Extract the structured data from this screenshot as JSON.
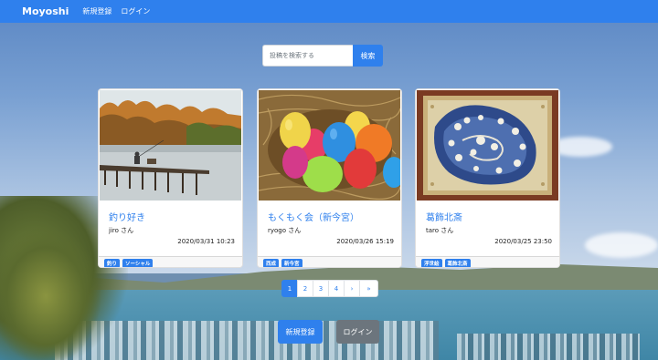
{
  "navbar": {
    "brand": "Moyoshi",
    "links": [
      "新規登録",
      "ログイン"
    ],
    "accent_color": "#2f80ed"
  },
  "search": {
    "placeholder": "投稿を検索する",
    "button_label": "検索"
  },
  "cards": [
    {
      "image": "lake-pier-photo",
      "title": "釣り好き",
      "author": "jiro さん",
      "date": "2020/03/31 10:23",
      "tags": [
        "釣り",
        "ソーシャル"
      ]
    },
    {
      "image": "easter-eggs-photo",
      "title": "もくもく会（新今宮）",
      "author": "ryogo さん",
      "date": "2020/03/26 15:19",
      "tags": [
        "西成",
        "新今宮"
      ]
    },
    {
      "image": "ukiyoe-wave-artwork",
      "title": "葛飾北斎",
      "author": "taro さん",
      "date": "2020/03/25 23:50",
      "tags": [
        "浮世絵",
        "葛飾北斎"
      ]
    }
  ],
  "pagination": {
    "pages": [
      "1",
      "2",
      "3",
      "4"
    ],
    "next": "›",
    "last": "»",
    "current": "1"
  },
  "actions": {
    "signup_label": "新規登録",
    "login_label": "ログイン"
  }
}
